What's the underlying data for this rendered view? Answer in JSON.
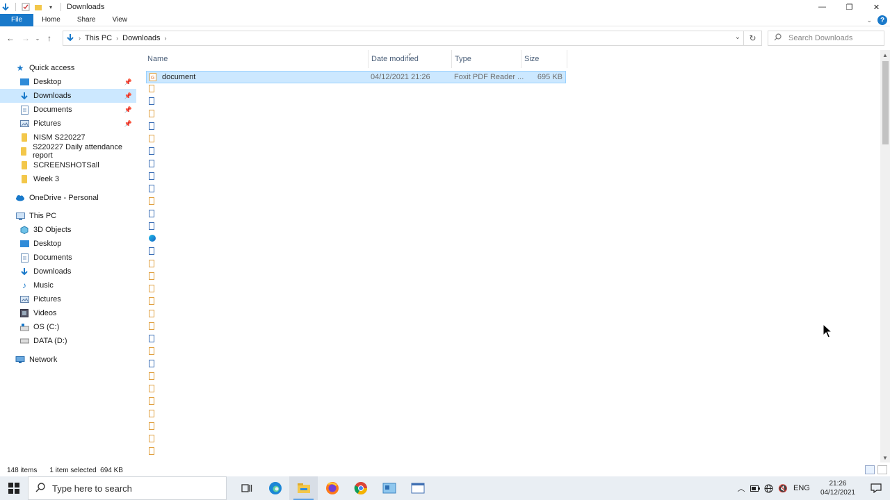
{
  "window": {
    "title": "Downloads",
    "caps": {
      "minimize": "—",
      "restore": "❐",
      "close": "✕"
    }
  },
  "ribbon": {
    "tabs": [
      "File",
      "Home",
      "Share",
      "View"
    ],
    "help": "?"
  },
  "address": {
    "crumbs": [
      "This PC",
      "Downloads"
    ],
    "search_placeholder": "Search Downloads"
  },
  "navpane": {
    "quick_access": "Quick access",
    "pinned": [
      "Desktop",
      "Downloads",
      "Documents",
      "Pictures"
    ],
    "recent": [
      "NISM S220227",
      "S220227 Daily attendance report",
      "SCREENSHOTSall",
      "Week 3"
    ],
    "onedrive": "OneDrive - Personal",
    "this_pc": "This PC",
    "pc_items": [
      "3D Objects",
      "Desktop",
      "Documents",
      "Downloads",
      "Music",
      "Pictures",
      "Videos",
      "OS (C:)",
      "DATA (D:)"
    ],
    "network": "Network"
  },
  "filelist": {
    "columns": [
      "Name",
      "Date modified",
      "Type",
      "Size"
    ],
    "selected_row": {
      "name": "document",
      "date": "04/12/2021 21:26",
      "type": "Foxit PDF Reader ...",
      "size": "695 KB"
    },
    "icon_types": [
      "pdf",
      "doc",
      "pdf",
      "doc",
      "pdf",
      "doc",
      "doc",
      "doc",
      "doc",
      "pdf",
      "doc",
      "doc",
      "edge",
      "doc",
      "pdf",
      "pdf",
      "pdf",
      "pdf",
      "pdf",
      "pdf",
      "doc",
      "pdf",
      "doc",
      "pdf",
      "pdf",
      "pdf",
      "pdf",
      "pdf",
      "pdf",
      "pdf"
    ]
  },
  "status": {
    "items": "148 items",
    "selected": "1 item selected  694 KB"
  },
  "taskbar": {
    "search_placeholder": "Type here to search",
    "lang": "ENG",
    "time": "21:26",
    "date": "04/12/2021"
  },
  "colors": {
    "accent": "#1979ca",
    "selection": "#cce8ff",
    "folder": "#f3c74a"
  }
}
